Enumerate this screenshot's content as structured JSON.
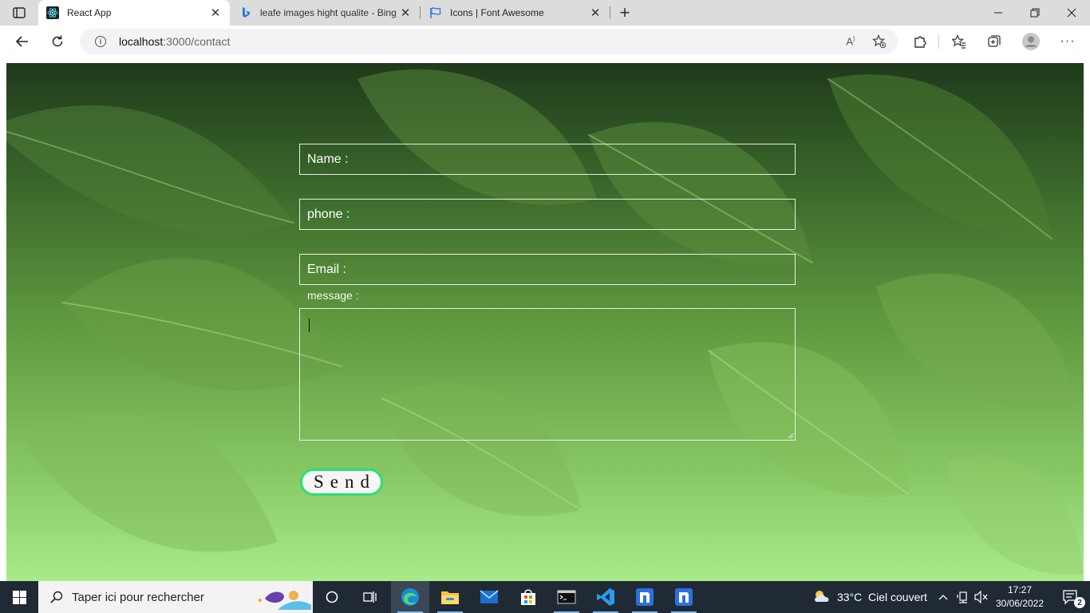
{
  "tabs": [
    {
      "title": "React App",
      "active": true,
      "favicon": "react-icon"
    },
    {
      "title": "leafe images hight qualite - Bing",
      "active": false,
      "favicon": "bing-icon"
    },
    {
      "title": "Icons | Font Awesome",
      "active": false,
      "favicon": "flag-icon"
    }
  ],
  "address": {
    "host": "localhost",
    "path": ":3000/contact"
  },
  "form": {
    "name_placeholder": "Name :",
    "phone_placeholder": "phone :",
    "email_placeholder": "Email :",
    "message_label": "message :",
    "send_label": "Send",
    "accent_color": "#27e07a"
  },
  "taskbar": {
    "search_placeholder": "Taper ici pour rechercher",
    "weather_temp": "33°C",
    "weather_desc": "Ciel couvert",
    "time": "17:27",
    "date": "30/06/2022",
    "notification_count": "2"
  }
}
